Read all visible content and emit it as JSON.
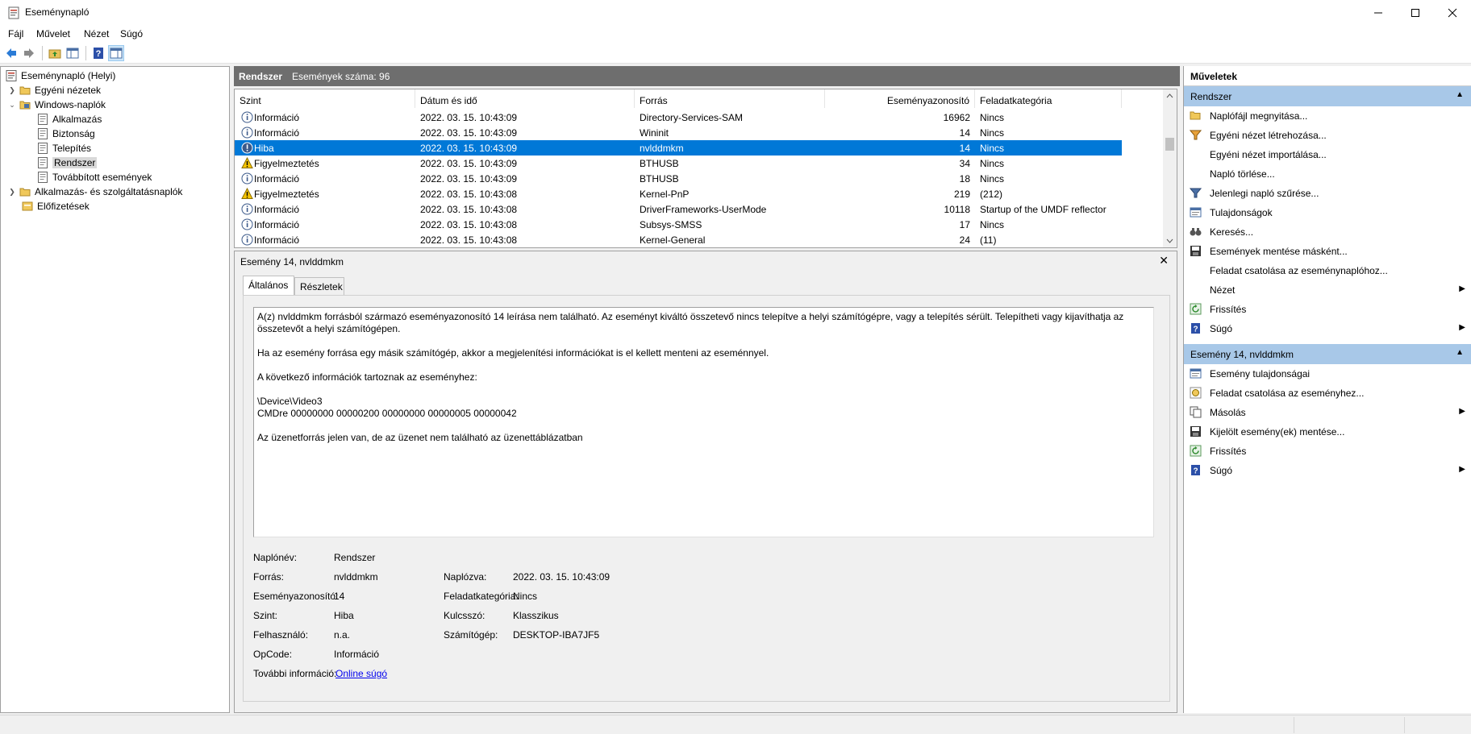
{
  "window": {
    "title": "Eseménynapló"
  },
  "menu": [
    "Fájl",
    "Művelet",
    "Nézet",
    "Súgó"
  ],
  "tree": {
    "root": "Eseménynapló (Helyi)",
    "items": [
      {
        "label": "Egyéni nézetek"
      },
      {
        "label": "Windows-naplók"
      },
      {
        "label": "Alkalmazás"
      },
      {
        "label": "Biztonság"
      },
      {
        "label": "Telepítés"
      },
      {
        "label": "Rendszer"
      },
      {
        "label": "Továbbított események"
      },
      {
        "label": "Alkalmazás- és szolgáltatásnaplók"
      },
      {
        "label": "Előfizetések"
      }
    ]
  },
  "center": {
    "log_name": "Rendszer",
    "event_count": "Események száma: 96"
  },
  "list": {
    "columns": [
      "Szint",
      "Dátum és idő",
      "Forrás",
      "Eseményazonosító",
      "Feladatkategória"
    ],
    "rows": [
      {
        "level": "Információ",
        "date": "2022. 03. 15. 10:43:09",
        "source": "Directory-Services-SAM",
        "id": "16962",
        "category": "Nincs",
        "type": "info"
      },
      {
        "level": "Információ",
        "date": "2022. 03. 15. 10:43:09",
        "source": "Wininit",
        "id": "14",
        "category": "Nincs",
        "type": "info"
      },
      {
        "level": "Hiba",
        "date": "2022. 03. 15. 10:43:09",
        "source": "nvlddmkm",
        "id": "14",
        "category": "Nincs",
        "type": "error"
      },
      {
        "level": "Figyelmeztetés",
        "date": "2022. 03. 15. 10:43:09",
        "source": "BTHUSB",
        "id": "34",
        "category": "Nincs",
        "type": "warn"
      },
      {
        "level": "Információ",
        "date": "2022. 03. 15. 10:43:09",
        "source": "BTHUSB",
        "id": "18",
        "category": "Nincs",
        "type": "info"
      },
      {
        "level": "Figyelmeztetés",
        "date": "2022. 03. 15. 10:43:08",
        "source": "Kernel-PnP",
        "id": "219",
        "category": "(212)",
        "type": "warn"
      },
      {
        "level": "Információ",
        "date": "2022. 03. 15. 10:43:08",
        "source": "DriverFrameworks-UserMode",
        "id": "10118",
        "category": "Startup of the UMDF reflector",
        "type": "info"
      },
      {
        "level": "Információ",
        "date": "2022. 03. 15. 10:43:08",
        "source": "Subsys-SMSS",
        "id": "17",
        "category": "Nincs",
        "type": "info"
      },
      {
        "level": "Információ",
        "date": "2022. 03. 15. 10:43:08",
        "source": "Kernel-General",
        "id": "24",
        "category": "(11)",
        "type": "info"
      }
    ]
  },
  "detail": {
    "title": "Esemény 14, nvlddmkm",
    "tabs": [
      "Általános",
      "Részletek"
    ],
    "message": [
      "A(z) nvlddmkm forrásból származó eseményazonosító 14 leírása nem található. Az eseményt kiváltó összetevő nincs telepítve a helyi számítógépre, vagy a telepítés sérült. Telepítheti vagy kijavíthatja az összetevőt a helyi számítógépen.",
      "Ha az esemény forrása egy másik számítógép, akkor a megjelenítési információkat is el kellett menteni az eseménnyel.",
      "A következő információk tartoznak az eseményhez:",
      "\\Device\\Video3\nCMDre 00000000 00000200 00000000 00000005 00000042",
      "Az üzenetforrás jelen van, de az üzenet nem található az üzenettáblázatban"
    ],
    "props": {
      "log_name_label": "Naplónév:",
      "log_name": "Rendszer",
      "source_label": "Forrás:",
      "source": "nvlddmkm",
      "logged_label": "Naplózva:",
      "logged": "2022. 03. 15. 10:43:09",
      "event_id_label": "Eseményazonosító:",
      "event_id": "14",
      "task_label": "Feladatkategória:",
      "task": "Nincs",
      "level_label": "Szint:",
      "level": "Hiba",
      "keywords_label": "Kulcsszó:",
      "keywords": "Klasszikus",
      "user_label": "Felhasználó:",
      "user": "n.a.",
      "computer_label": "Számítógép:",
      "computer": "DESKTOP-IBA7JF5",
      "opcode_label": "OpCode:",
      "opcode": "Információ",
      "more_label": "További információ:",
      "more_link": "Online súgó"
    }
  },
  "actions": {
    "title": "Műveletek",
    "group1": "Rendszer",
    "group1_items": [
      {
        "label": "Naplófájl megnyitása...",
        "icon": "open-folder-icon"
      },
      {
        "label": "Egyéni nézet létrehozása...",
        "icon": "filter-icon"
      },
      {
        "label": "Egyéni nézet importálása...",
        "icon": ""
      },
      {
        "label": "Napló törlése...",
        "icon": ""
      },
      {
        "label": "Jelenlegi napló szűrése...",
        "icon": "filter-icon"
      },
      {
        "label": "Tulajdonságok",
        "icon": "properties-icon"
      },
      {
        "label": "Keresés...",
        "icon": "binoculars-icon"
      },
      {
        "label": "Események mentése másként...",
        "icon": "save-icon"
      },
      {
        "label": "Feladat csatolása az eseménynaplóhoz...",
        "icon": ""
      },
      {
        "label": "Nézet",
        "icon": "",
        "submenu": true
      },
      {
        "label": "Frissítés",
        "icon": "refresh-icon"
      },
      {
        "label": "Súgó",
        "icon": "help-icon",
        "submenu": true
      }
    ],
    "group2": "Esemény 14, nvlddmkm",
    "group2_items": [
      {
        "label": "Esemény tulajdonságai",
        "icon": "properties-icon"
      },
      {
        "label": "Feladat csatolása az eseményhez...",
        "icon": "task-icon"
      },
      {
        "label": "Másolás",
        "icon": "copy-icon",
        "submenu": true
      },
      {
        "label": "Kijelölt esemény(ek) mentése...",
        "icon": "save-icon"
      },
      {
        "label": "Frissítés",
        "icon": "refresh-icon"
      },
      {
        "label": "Súgó",
        "icon": "help-icon",
        "submenu": true
      }
    ]
  }
}
